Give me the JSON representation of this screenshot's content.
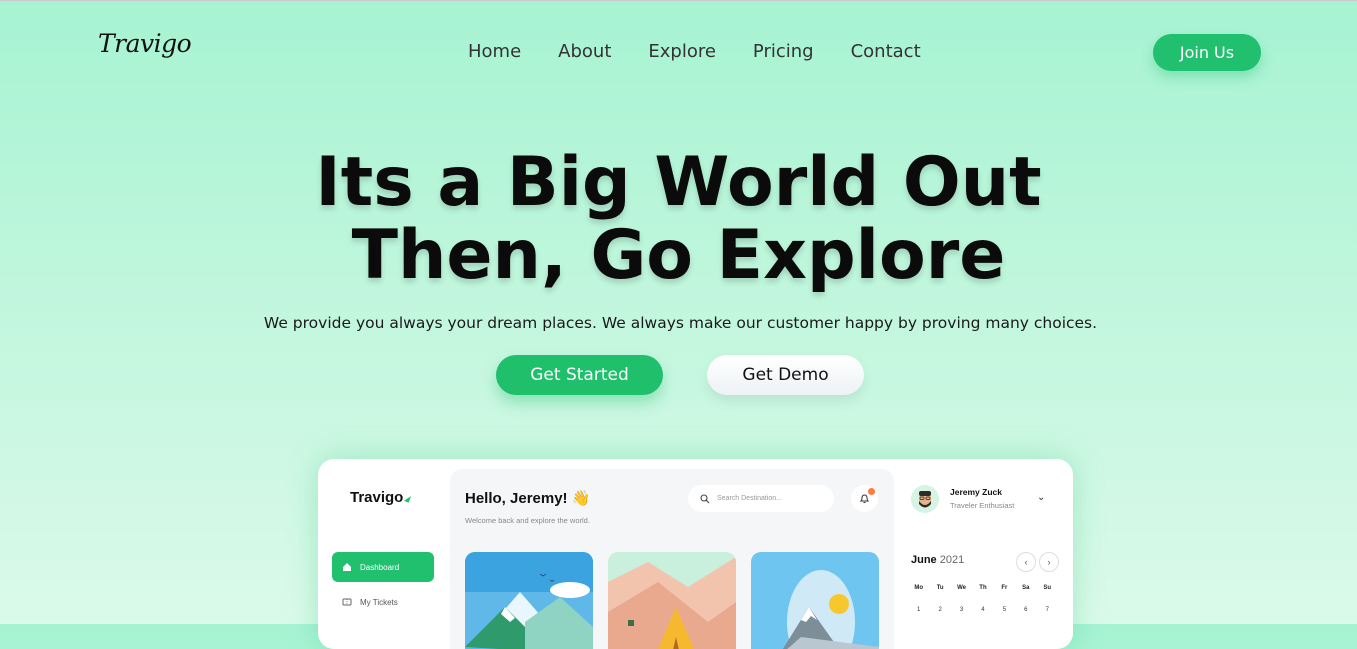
{
  "brand": {
    "logo": "Travigo"
  },
  "nav": {
    "items": [
      "Home",
      "About",
      "Explore",
      "Pricing",
      "Contact"
    ]
  },
  "header": {
    "join_label": "Join Us"
  },
  "hero": {
    "title_line1": "Its a Big World Out",
    "title_line2": "Then, Go Explore",
    "subtitle": "We provide you always your dream places. We always make our customer happy by proving many choices.",
    "primary_cta": "Get Started",
    "secondary_cta": "Get Demo"
  },
  "dashboard": {
    "logo": "Travigo",
    "sidebar": [
      {
        "label": "Dashboard",
        "active": true,
        "icon": "home-icon"
      },
      {
        "label": "My Tickets",
        "active": false,
        "icon": "ticket-icon"
      }
    ],
    "greeting": "Hello, Jeremy! 👋",
    "greeting_sub": "Welcome back and explore the world.",
    "search_placeholder": "Search Destination...",
    "user": {
      "name": "Jeremy Zuck",
      "role": "Traveler Enthusiast"
    },
    "calendar": {
      "month": "June",
      "year": "2021",
      "weekdays": [
        "Mo",
        "Tu",
        "We",
        "Th",
        "Fr",
        "Sa",
        "Su"
      ],
      "first_week": [
        "1",
        "2",
        "3",
        "4",
        "5",
        "6",
        "7"
      ]
    }
  },
  "colors": {
    "accent": "#20c06e",
    "notification": "#ff7a3d"
  }
}
